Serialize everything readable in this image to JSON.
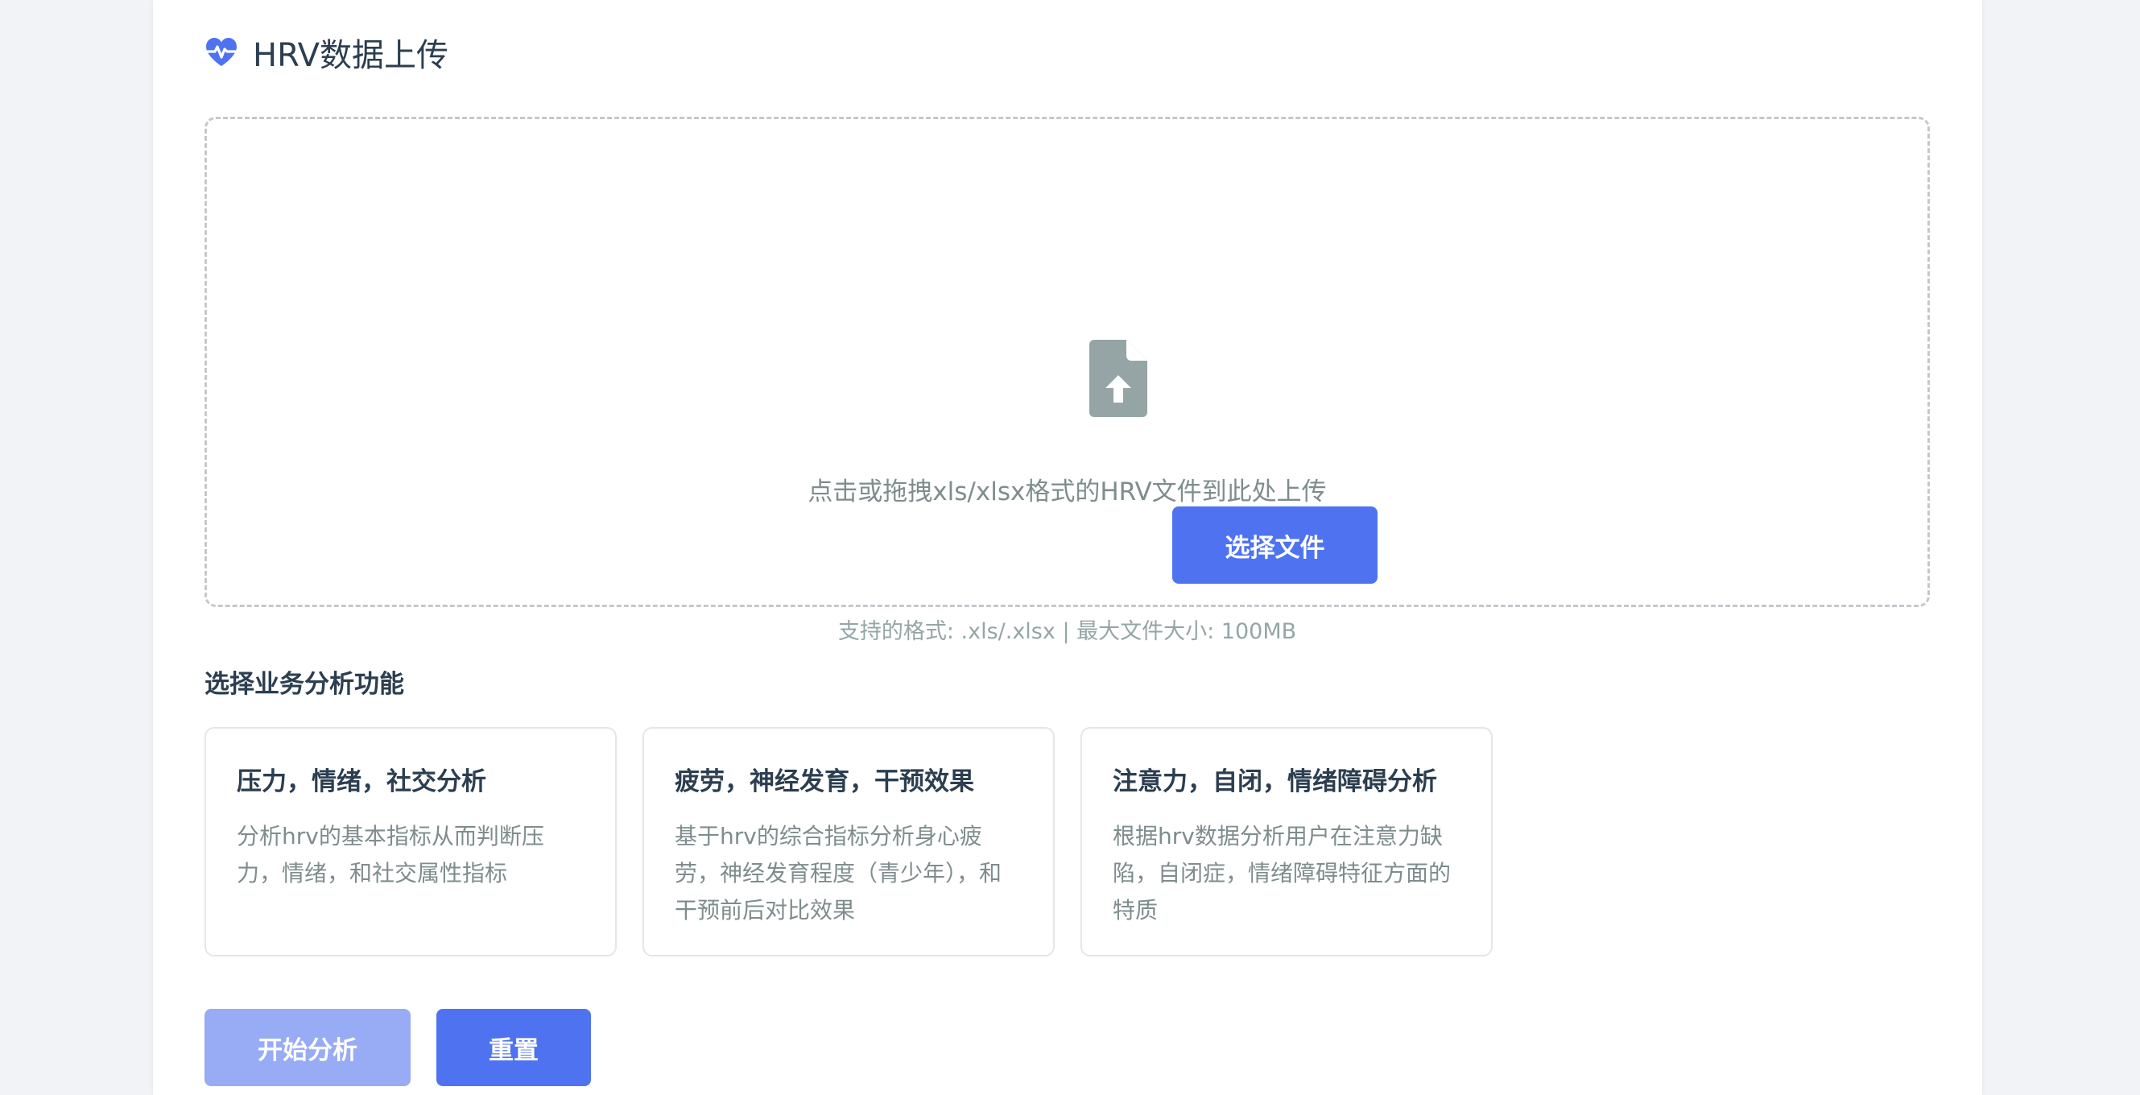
{
  "header": {
    "icon": "heartbeat-icon",
    "title": "HRV数据上传"
  },
  "upload": {
    "icon": "file-upload-icon",
    "hint": "点击或拖拽xls/xlsx格式的HRV文件到此处上传",
    "choose_label": "选择文件",
    "format_note": "支持的格式: .xls/.xlsx | 最大文件大小: 100MB"
  },
  "analysis": {
    "section_title": "选择业务分析功能",
    "options": [
      {
        "title": "压力，情绪，社交分析",
        "description": "分析hrv的基本指标从而判断压力，情绪，和社交属性指标"
      },
      {
        "title": "疲劳，神经发育，干预效果",
        "description": "基于hrv的综合指标分析身心疲劳，神经发育程度（青少年），和干预前后对比效果"
      },
      {
        "title": "注意力，自闭，情绪障碍分析",
        "description": "根据hrv数据分析用户在注意力缺陷，自闭症，情绪障碍特征方面的特质"
      }
    ]
  },
  "actions": {
    "start_label": "开始分析",
    "reset_label": "重置"
  },
  "colors": {
    "accent": "#4f73f0",
    "accent_disabled": "#98acf5",
    "icon_gray": "#95a5a6",
    "text_dark": "#2c3e50",
    "text_muted": "#7f8c8d",
    "background": "#f1f3f7"
  }
}
